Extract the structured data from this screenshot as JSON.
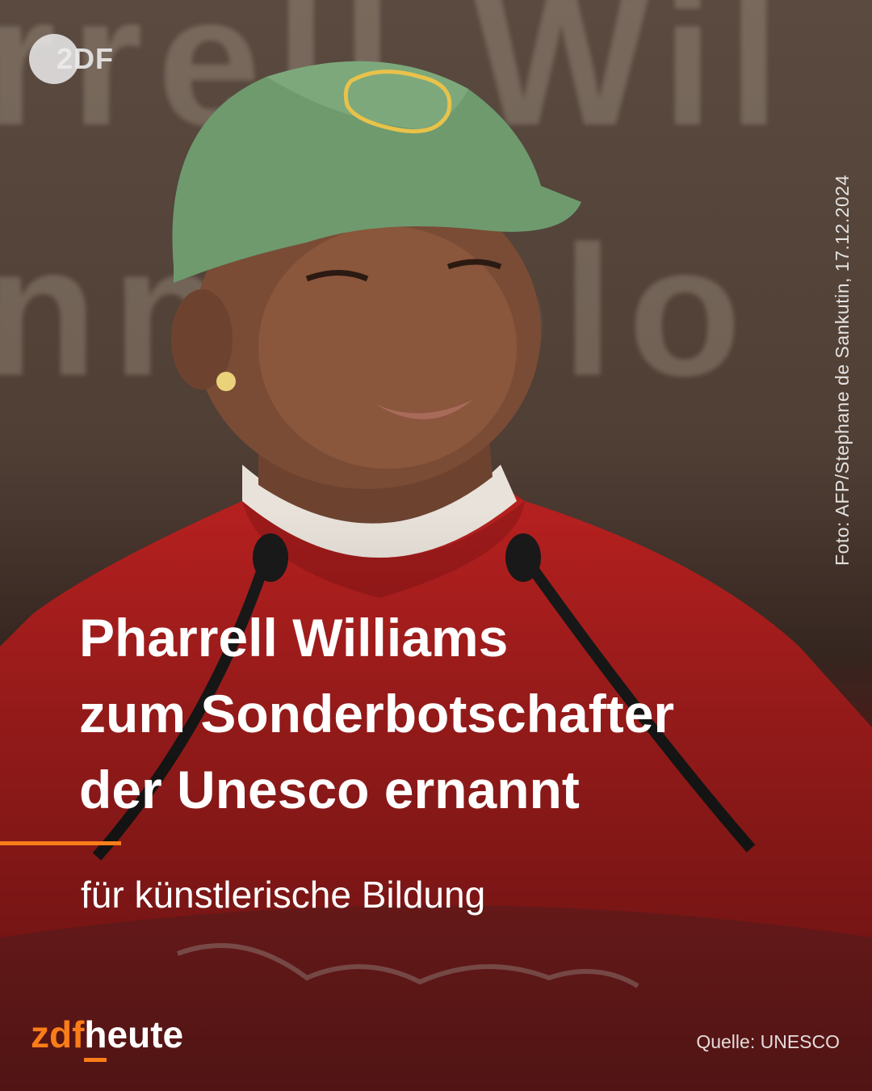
{
  "watermark": {
    "logo_text": "2DF"
  },
  "photo_credit": "Foto: AFP/Stephane de Sankutin, 17.12.2024",
  "headline": {
    "line1": "Pharrell Williams",
    "line2": "zum Sonderbotschafter",
    "line3": "der Unesco ernannt"
  },
  "subline": "für künstlerische Bildung",
  "brand": {
    "part1": "zdf",
    "part2": "heute"
  },
  "source": "Quelle: UNESCO",
  "colors": {
    "accent": "#fa7d19",
    "text": "#ffffff"
  }
}
